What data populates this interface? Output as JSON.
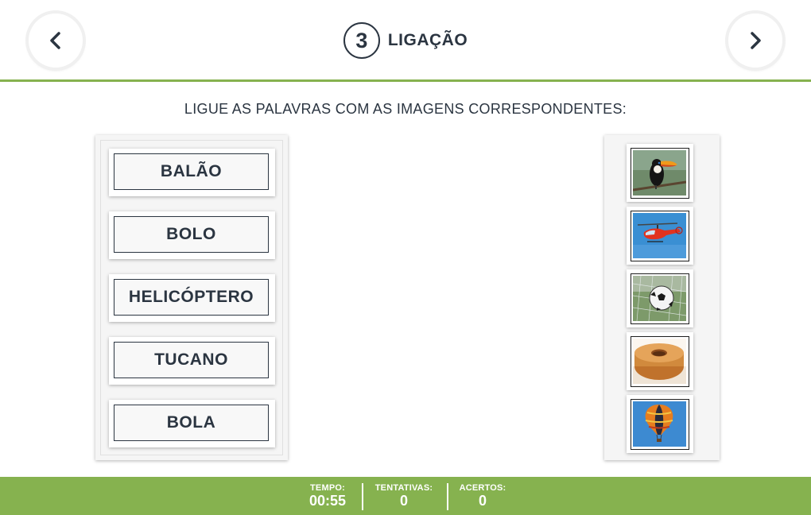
{
  "header": {
    "step_number": "3",
    "title": "LIGAÇÃO",
    "prev_icon": "chevron-left-icon",
    "next_icon": "chevron-right-icon"
  },
  "instruction": "LIGUE AS PALAVRAS COM AS IMAGENS CORRESPONDENTES:",
  "words": [
    "BALÃO",
    "BOLO",
    "HELICÓPTERO",
    "TUCANO",
    "BOLA"
  ],
  "images": [
    "toucan",
    "helicopter",
    "soccer-ball",
    "cake",
    "hot-air-balloon"
  ],
  "footer": {
    "time_label": "TEMPO:",
    "time_value": "00:55",
    "attempts_label": "TENTATIVAS:",
    "attempts_value": "0",
    "hits_label": "ACERTOS:",
    "hits_value": "0"
  },
  "colors": {
    "accent_green": "#86b24f",
    "text_dark": "#2b3541"
  }
}
